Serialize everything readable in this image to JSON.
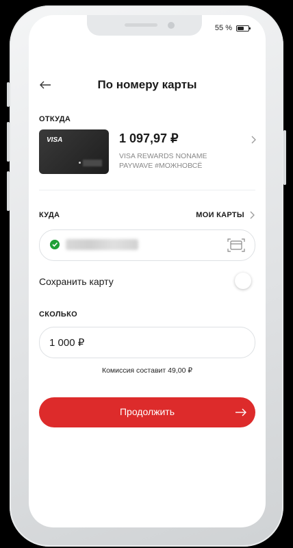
{
  "status_bar": {
    "battery": "55 %",
    "battery_level": 0.55
  },
  "header": {
    "title": "По номеру карты"
  },
  "from": {
    "label": "ОТКУДА",
    "card_brand": "VISA",
    "balance": "1 097,97 ₽",
    "card_name_line1": "VISA REWARDS NONAME",
    "card_name_line2": "PAYWAVE #МОЖНОВСЁ"
  },
  "to": {
    "label": "КУДА",
    "my_cards_label": "МОИ КАРТЫ",
    "bank_logo_color": "#21a038"
  },
  "save_card": {
    "label": "Сохранить карту",
    "enabled": false
  },
  "amount": {
    "label": "СКОЛЬКО",
    "value": "1 000 ₽"
  },
  "commission": {
    "text": "Комиссия составит  49,00 ₽"
  },
  "continue": {
    "label": "Продолжить"
  },
  "colors": {
    "accent": "#dd2b2b",
    "card_dark": "#2b2b2b"
  },
  "icons": [
    "back-arrow-icon",
    "chevron-right-icon",
    "card-scan-icon",
    "arrow-right-icon"
  ]
}
